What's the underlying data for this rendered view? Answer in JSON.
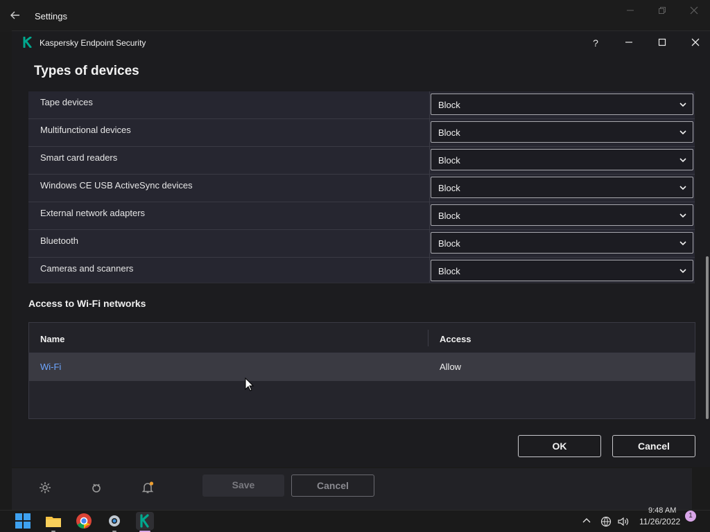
{
  "outer_window": {
    "title": "Settings"
  },
  "dialog": {
    "app_title": "Kaspersky Endpoint Security",
    "help_label": "?",
    "section_title": "Types of devices",
    "devices": [
      {
        "label": "Tape devices",
        "value": "Block"
      },
      {
        "label": "Multifunctional devices",
        "value": "Block"
      },
      {
        "label": "Smart card readers",
        "value": "Block"
      },
      {
        "label": "Windows CE USB ActiveSync devices",
        "value": "Block"
      },
      {
        "label": "External network adapters",
        "value": "Block"
      },
      {
        "label": "Bluetooth",
        "value": "Block"
      },
      {
        "label": "Cameras and scanners",
        "value": "Block"
      }
    ],
    "wifi_section_title": "Access to Wi-Fi networks",
    "wifi_table": {
      "columns": [
        "Name",
        "Access"
      ],
      "rows": [
        {
          "name": "Wi-Fi",
          "access": "Allow"
        }
      ]
    },
    "ok_label": "OK",
    "cancel_label": "Cancel"
  },
  "settings_bar": {
    "save_label": "Save",
    "cancel_label": "Cancel"
  },
  "taskbar": {
    "time": "9:48 AM",
    "date": "11/26/2022",
    "notification_count": "1"
  },
  "colors": {
    "accent_link": "#6ea6ff",
    "kaspersky_green": "#00a88e"
  }
}
